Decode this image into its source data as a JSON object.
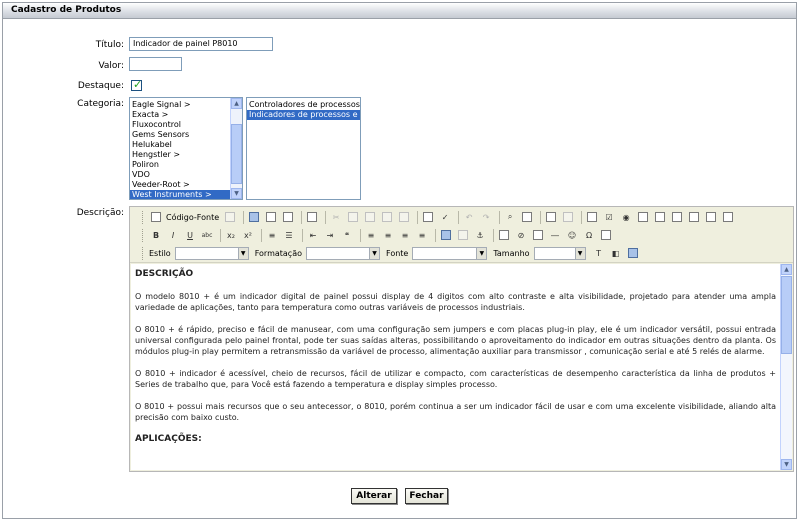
{
  "panel": {
    "title": "Cadastro de Produtos"
  },
  "form": {
    "titulo_label": "Título:",
    "titulo_value": "Indicador de painel  P8010",
    "valor_label": "Valor:",
    "valor_value": "",
    "destaque_label": "Destaque:",
    "destaque_checked": true,
    "categoria_label": "Categoria:",
    "categoria_items": [
      "Eagle Signal >",
      "Exacta >",
      "Fluxocontrol",
      "Gems Sensors",
      "Helukabel",
      "Hengstler >",
      "Poliron",
      "VDO",
      "Veeder-Root >",
      "West Instruments >"
    ],
    "categoria_selected": "West Instruments >",
    "subcategoria_items": [
      "Controladores de processos e",
      "Indicadores de processos e te"
    ],
    "subcategoria_selected": "Indicadores de processos e te",
    "descricao_label": "Descrição:"
  },
  "editor": {
    "source_label": "Código-Fonte",
    "estilo_label": "Estilo",
    "formatacao_label": "Formatação",
    "fonte_label": "Fonte",
    "tamanho_label": "Tamanho",
    "content": {
      "heading1": "DESCRIÇÃO",
      "p1": "O modelo 8010 + é um indicador digital de painel possui display de 4 digitos com alto contraste e  alta visibilidade, projetado para atender uma  ampla variedade de aplicações, tanto para temperatura como outras variáveis de processos industriais.",
      "p2": "O 8010 + é rápido, preciso e fácil de manusear, com uma configuração sem  jumpers e com placas plug-in play,  ele é um indicador versátil, possui entrada universal configurada pelo painel frontal, pode ter suas saídas alteras, possibilitando o aproveitamento do indicador em outras situações dentro da planta. Os módulos plug-in play permitem a retransmissão da variável de processo, alimentação auxiliar para  transmissor , comunicação serial e até 5 relés de alarme.",
      "p3": "O 8010 + indicador é acessível, cheio de recursos, fácil de utilizar e compacto, com características de desempenho  característica da linha de produtos + Series de trabalho que, para Você está fazendo a temperatura e display simples processo.",
      "p4": "O 8010 +  possui mais recursos que o seu antecessor, o 8010, porém continua a ser um indicador fácil de usar e com uma excelente visibilidade, aliando  alta precisão com baixo custo.",
      "heading2": "APLICAÇÕES:"
    }
  },
  "actions": {
    "alterar": "Alterar",
    "fechar": "Fechar"
  }
}
